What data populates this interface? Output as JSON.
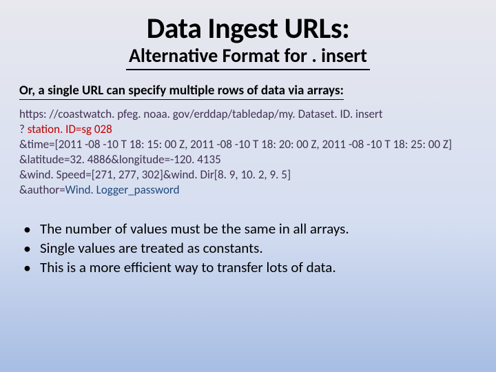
{
  "slide": {
    "title": "Data Ingest URLs:",
    "subtitle": "Alternative Format for . insert",
    "intro": "Or, a single URL can specify multiple rows of data via arrays:",
    "code_line1": "https: //coastwatch. pfeg. noaa. gov/erddap/tabledap/my. Dataset. ID. insert",
    "code_line2a": "? ",
    "code_line2b": "station. ID=sg 028",
    "code_line3": "&time=[2011 -08 -10 T 18: 15: 00 Z, 2011 -08 -10 T 18: 20: 00 Z, 2011 -08 -10 T 18: 25: 00 Z]",
    "code_line4": "&latitude=32. 4886&longitude=-120. 4135",
    "code_line5": "&wind. Speed=[271, 277, 302]&wind. Dir[8. 9, 10. 2, 9. 5]",
    "code_line6a": "&author=",
    "code_line6b": "Wind. Logger_password",
    "bullets": [
      "The number of values must be the same in all arrays.",
      "Single values are treated as constants.",
      "This is a more efficient way to transfer lots of data."
    ]
  }
}
